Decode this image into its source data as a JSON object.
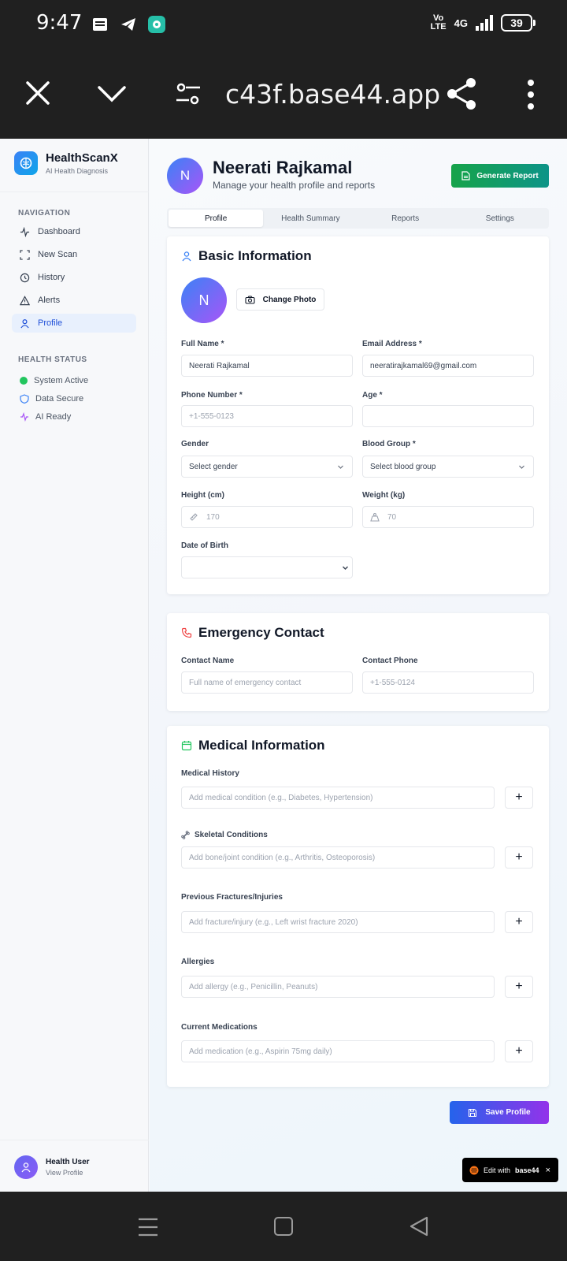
{
  "status_bar": {
    "time": "9:47",
    "network": "4G",
    "volte": "Vo LTE",
    "battery": "39"
  },
  "browser": {
    "url": "c43f.base44.app"
  },
  "sidebar": {
    "brand_name": "HealthScanX",
    "brand_sub": "AI Health Diagnosis",
    "nav_heading": "NAVIGATION",
    "nav_items": [
      {
        "label": "Dashboard",
        "icon": "activity-icon"
      },
      {
        "label": "New Scan",
        "icon": "scan-icon"
      },
      {
        "label": "History",
        "icon": "history-icon"
      },
      {
        "label": "Alerts",
        "icon": "alert-triangle-icon"
      },
      {
        "label": "Profile",
        "icon": "user-icon",
        "active": true
      }
    ],
    "status_heading": "HEALTH STATUS",
    "status_items": [
      {
        "label": "System Active",
        "icon": "green-dot-icon"
      },
      {
        "label": "Data Secure",
        "icon": "shield-icon"
      },
      {
        "label": "AI Ready",
        "icon": "pulse-icon"
      }
    ],
    "user_name": "Health User",
    "user_link": "View Profile"
  },
  "header": {
    "avatar_initial": "N",
    "name": "Neerati Rajkamal",
    "subtitle": "Manage your health profile and reports",
    "generate_label": "Generate Report"
  },
  "tabs": [
    "Profile",
    "Health Summary",
    "Reports",
    "Settings"
  ],
  "basic": {
    "title": "Basic Information",
    "avatar_initial": "N",
    "change_photo": "Change Photo",
    "full_name_label": "Full Name *",
    "full_name_value": "Neerati Rajkamal",
    "email_label": "Email Address *",
    "email_value": "neeratirajkamal69@gmail.com",
    "phone_label": "Phone Number *",
    "phone_placeholder": "+1-555-0123",
    "age_label": "Age *",
    "age_value": "",
    "gender_label": "Gender",
    "gender_value": "Select gender",
    "blood_label": "Blood Group *",
    "blood_value": "Select blood group",
    "height_label": "Height (cm)",
    "height_placeholder": "170",
    "weight_label": "Weight (kg)",
    "weight_placeholder": "70",
    "dob_label": "Date of Birth",
    "dob_value": ""
  },
  "emergency": {
    "title": "Emergency Contact",
    "name_label": "Contact Name",
    "name_placeholder": "Full name of emergency contact",
    "phone_label": "Contact Phone",
    "phone_placeholder": "+1-555-0124"
  },
  "medical": {
    "title": "Medical Information",
    "history_label": "Medical History",
    "history_placeholder": "Add medical condition (e.g., Diabetes, Hypertension)",
    "skeletal_label": "Skeletal Conditions",
    "skeletal_placeholder": "Add bone/joint condition (e.g., Arthritis, Osteoporosis)",
    "fractures_label": "Previous Fractures/Injuries",
    "fractures_placeholder": "Add fracture/injury (e.g., Left wrist fracture 2020)",
    "allergies_label": "Allergies",
    "allergies_placeholder": "Add allergy (e.g., Penicillin, Peanuts)",
    "medications_label": "Current Medications",
    "medications_placeholder": "Add medication (e.g., Aspirin 75mg daily)",
    "add_symbol": "+"
  },
  "save_label": "Save Profile",
  "base44_badge": {
    "prefix": "Edit with",
    "brand": "base44",
    "close": "×"
  },
  "colors": {
    "primary": "#2563eb",
    "accent": "#9333ea",
    "success": "#16a34a"
  }
}
